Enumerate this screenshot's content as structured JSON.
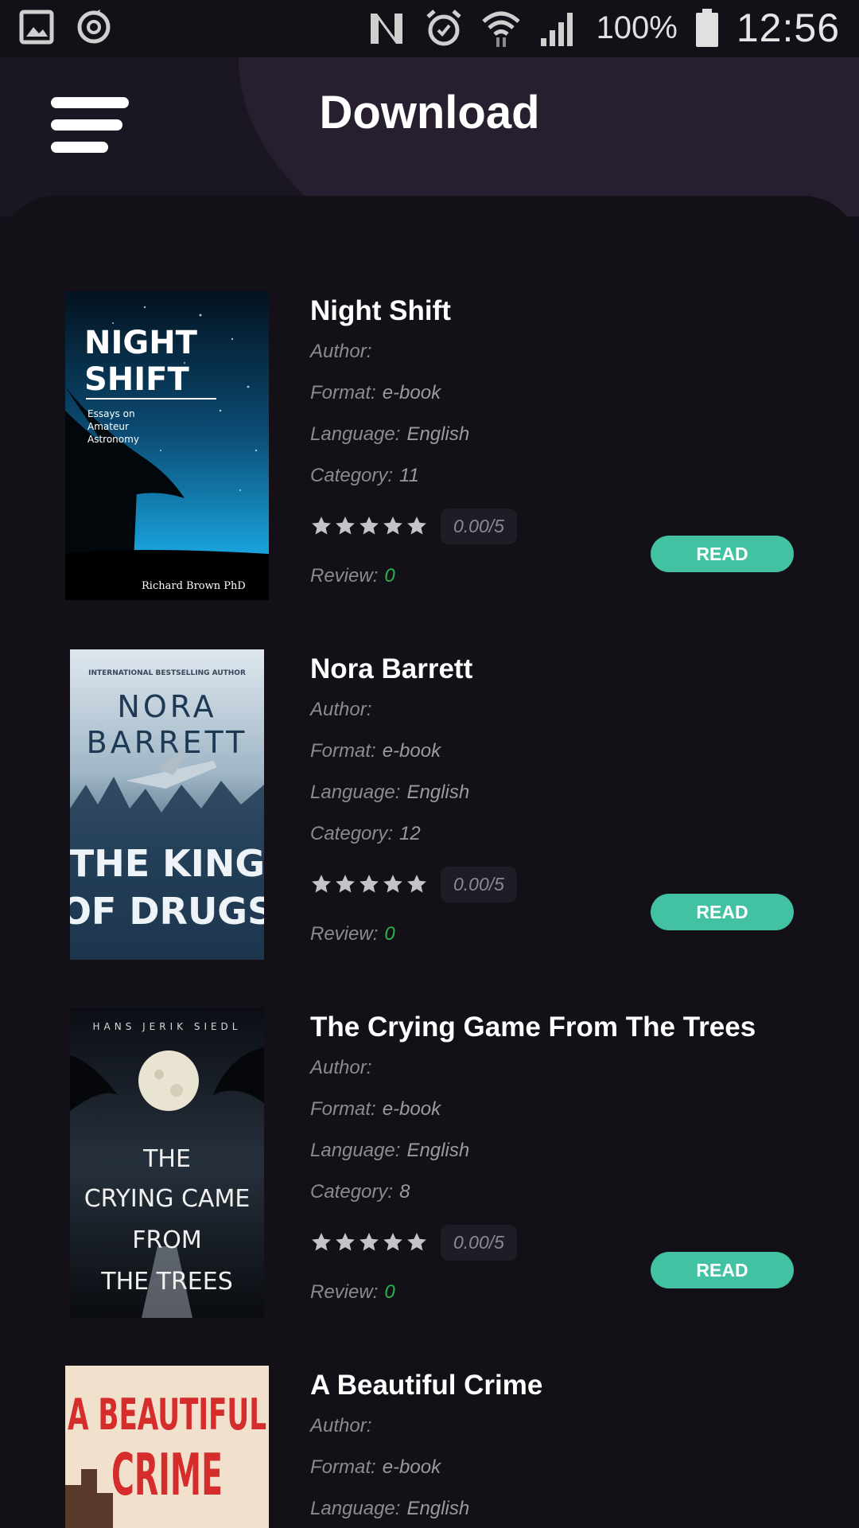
{
  "status_bar": {
    "battery": "100%",
    "time": "12:56",
    "icons": [
      "gallery-icon",
      "sync-icon",
      "nfc-icon",
      "alarm-icon",
      "wifi-icon",
      "signal-icon",
      "battery-icon"
    ]
  },
  "header": {
    "title": "Download",
    "menu_icon": "hamburger-menu-icon"
  },
  "labels": {
    "author": "Author:",
    "format": "Format:",
    "language": "Language:",
    "category": "Category:",
    "review": "Review:",
    "read": "READ"
  },
  "books": [
    {
      "title": "Night Shift",
      "author": "",
      "format": "e-book",
      "language": "English",
      "category": "11",
      "rating": "0.00/5",
      "review": "0",
      "cover": {
        "title_line1": "NIGHT",
        "title_line2": "SHIFT",
        "subtitle": [
          "Essays on",
          "Amateur",
          "Astronomy"
        ],
        "author": "Richard Brown PhD"
      }
    },
    {
      "title": "Nora Barrett",
      "author": "",
      "format": "e-book",
      "language": "English",
      "category": "12",
      "rating": "0.00/5",
      "review": "0",
      "cover": {
        "tagline": "INTERNATIONAL BESTSELLING AUTHOR",
        "author_line1": "NORA",
        "author_line2": "BARRETT",
        "title_line1": "THE KING",
        "title_line2": "OF DRUGS"
      }
    },
    {
      "title": "The Crying Game From The Trees",
      "author": "",
      "format": "e-book",
      "language": "English",
      "category": "8",
      "rating": "0.00/5",
      "review": "0",
      "cover": {
        "author": "HANS JERIK SIEDL",
        "title_lines": [
          "THE",
          "CRYING CAME",
          "FROM",
          "THE TREES"
        ]
      }
    },
    {
      "title": "A Beautiful Crime",
      "author": "",
      "format": "e-book",
      "language": "English",
      "category": "",
      "rating": "",
      "review": "",
      "cover": {
        "title_line1": "A BEAUTIFUL",
        "title_line2": "CRIME"
      }
    }
  ],
  "colors": {
    "accent": "#42c2a2",
    "review_count": "#2bb24c",
    "background": "#131117"
  }
}
